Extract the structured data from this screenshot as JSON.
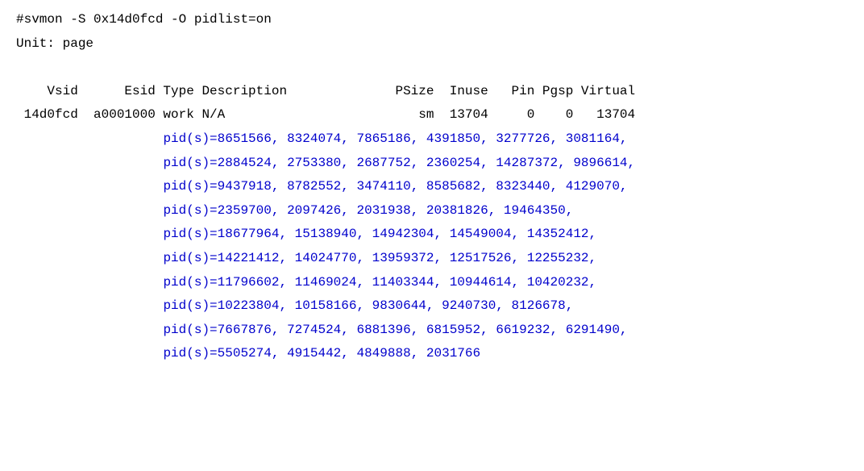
{
  "command": "#svmon -S 0x14d0fcd -O pidlist=on",
  "unit_line": "Unit: page",
  "blank": " ",
  "header": "    Vsid      Esid Type Description              PSize  Inuse   Pin Pgsp Virtual",
  "row": " 14d0fcd  a0001000 work N/A                         sm  13704     0    0   13704",
  "pid_prefix": "                   ",
  "pids": [
    "pid(s)=8651566, 8324074, 7865186, 4391850, 3277726, 3081164,",
    "pid(s)=2884524, 2753380, 2687752, 2360254, 14287372, 9896614,",
    "pid(s)=9437918, 8782552, 3474110, 8585682, 8323440, 4129070,",
    "pid(s)=2359700, 2097426, 2031938, 20381826, 19464350,",
    "pid(s)=18677964, 15138940, 14942304, 14549004, 14352412,",
    "pid(s)=14221412, 14024770, 13959372, 12517526, 12255232,",
    "pid(s)=11796602, 11469024, 11403344, 10944614, 10420232,",
    "pid(s)=10223804, 10158166, 9830644, 9240730, 8126678,",
    "pid(s)=7667876, 7274524, 6881396, 6815952, 6619232, 6291490,",
    "pid(s)=5505274, 4915442, 4849888, 2031766"
  ]
}
